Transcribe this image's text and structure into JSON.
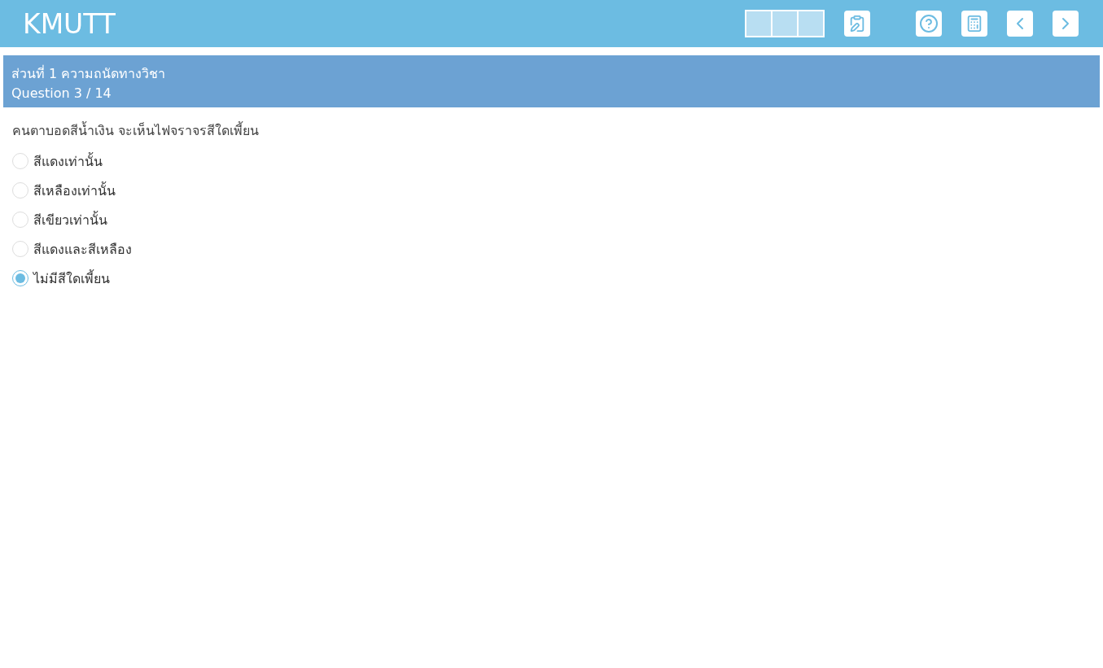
{
  "header": {
    "title": "KMUTT"
  },
  "section": {
    "title": "ส่วนที่ 1 ความถนัดทางวิชา",
    "progress": "Question 3 / 14"
  },
  "question": {
    "text": "คนตาบอดสีน้ำเงิน จะเห็นไฟจราจรสีใดเพี้ยน",
    "options": [
      {
        "label": "สีแดงเท่านั้น",
        "selected": false
      },
      {
        "label": "สีเหลืองเท่านั้น",
        "selected": false
      },
      {
        "label": "สีเขียวเท่านั้น",
        "selected": false
      },
      {
        "label": "สีแดงและสีเหลือง",
        "selected": false
      },
      {
        "label": "ไม่มีสีใดเพี้ยน",
        "selected": true
      }
    ]
  }
}
